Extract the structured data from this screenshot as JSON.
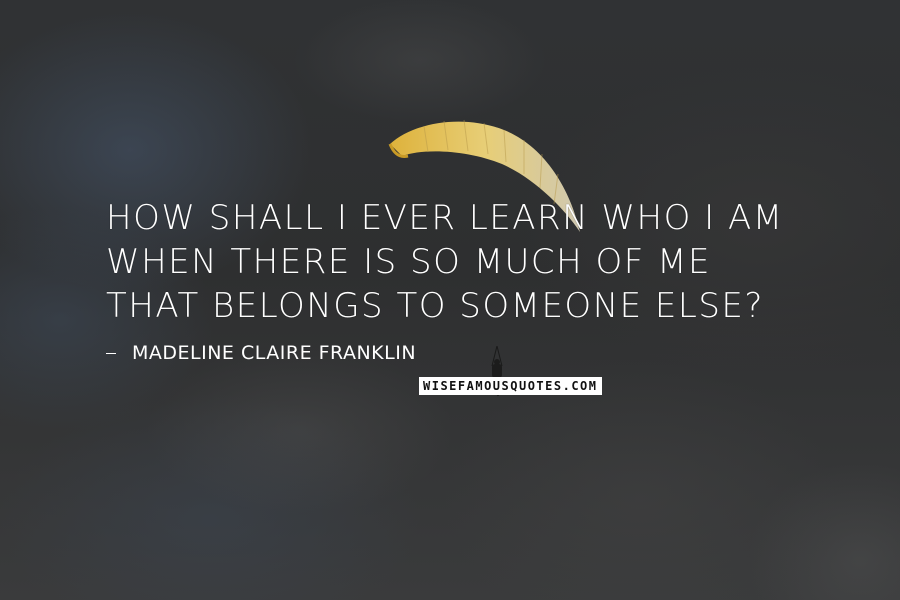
{
  "quote": {
    "text": "HOW SHALL I EVER LEARN WHO I AM WHEN THERE IS SO MUCH OF ME THAT BELONGS TO SOMEONE ELSE?"
  },
  "author": {
    "name": "MADELINE CLAIRE FRANKLIN"
  },
  "watermark": {
    "text": "WISEFAMOUSQUOTES.COM"
  },
  "colors": {
    "text": "#ffffff",
    "canopy": "#e8c24a",
    "background": "#2e2f30"
  },
  "icons": {
    "glider": "paraglider-canopy-icon",
    "pilot": "paraglider-pilot-icon"
  }
}
